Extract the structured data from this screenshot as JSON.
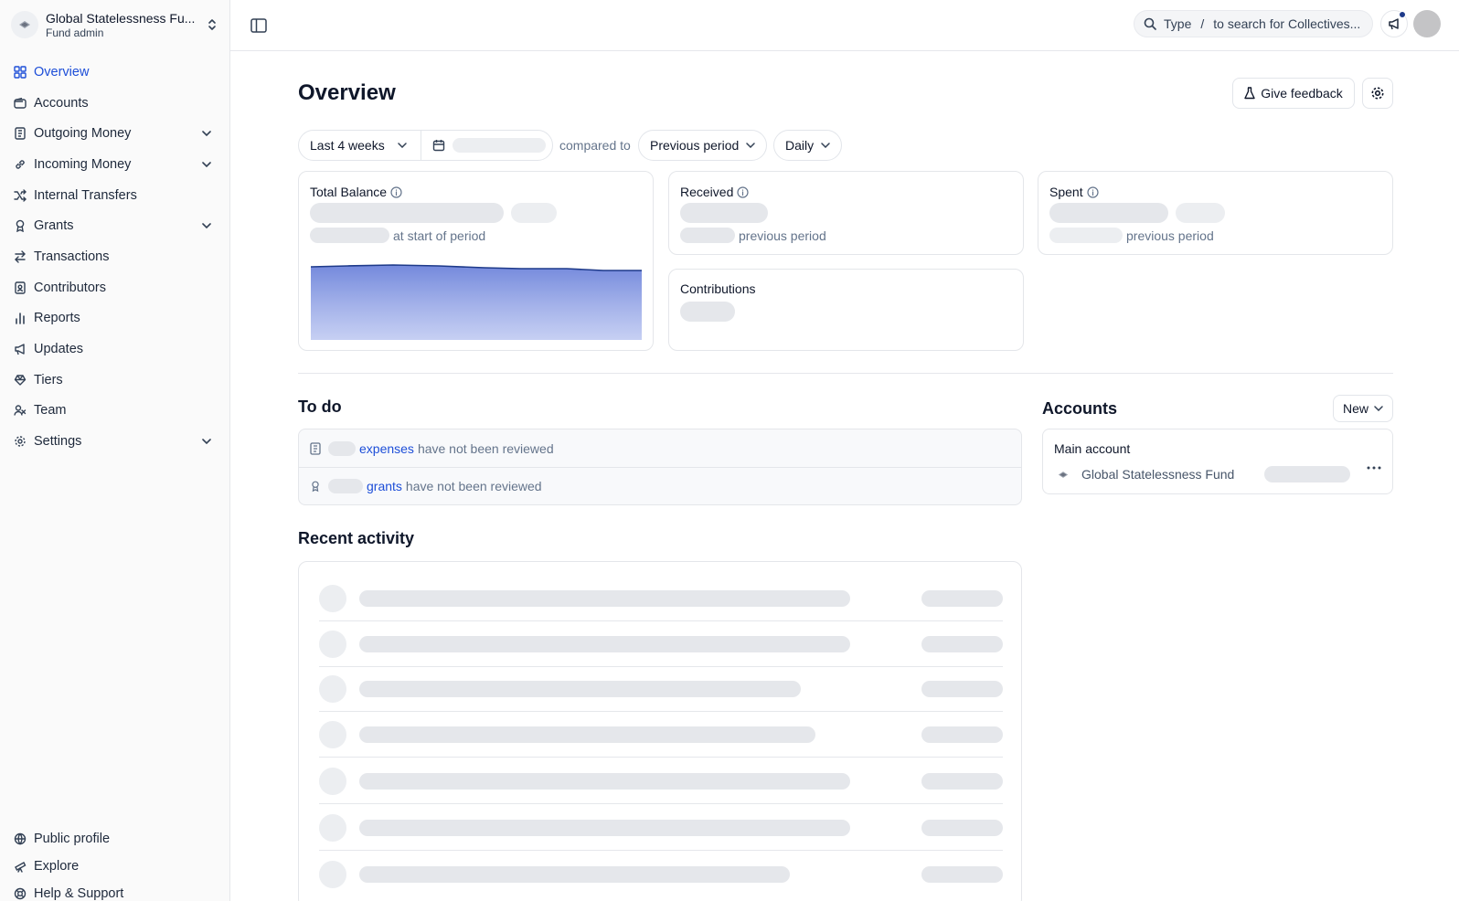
{
  "org": {
    "name": "Global Statelessness Fu...",
    "role": "Fund admin"
  },
  "nav": [
    {
      "label": "Overview",
      "icon": "grid-icon",
      "active": true
    },
    {
      "label": "Accounts",
      "icon": "wallet-icon"
    },
    {
      "label": "Outgoing Money",
      "icon": "receipt-icon",
      "expandable": true
    },
    {
      "label": "Incoming Money",
      "icon": "link-icon",
      "expandable": true
    },
    {
      "label": "Internal Transfers",
      "icon": "shuffle-icon"
    },
    {
      "label": "Grants",
      "icon": "award-icon",
      "expandable": true
    },
    {
      "label": "Transactions",
      "icon": "arrows-icon"
    },
    {
      "label": "Contributors",
      "icon": "contacts-icon"
    },
    {
      "label": "Reports",
      "icon": "bar-chart-icon"
    },
    {
      "label": "Updates",
      "icon": "megaphone-icon"
    },
    {
      "label": "Tiers",
      "icon": "tag-icon"
    },
    {
      "label": "Team",
      "icon": "users-icon"
    },
    {
      "label": "Settings",
      "icon": "gear-icon",
      "expandable": true
    }
  ],
  "nav_bottom": [
    {
      "label": "Public profile",
      "icon": "globe-icon"
    },
    {
      "label": "Explore",
      "icon": "telescope-icon"
    },
    {
      "label": "Help & Support",
      "icon": "lifebuoy-icon"
    }
  ],
  "search": {
    "type": "Type",
    "slash": "/",
    "hint": "to search for Collectives..."
  },
  "page": {
    "title": "Overview",
    "feedback_label": "Give feedback"
  },
  "filters": {
    "period": "Last 4 weeks",
    "compared_to": "compared to",
    "comparison": "Previous period",
    "interval": "Daily"
  },
  "cards": {
    "total_balance": {
      "title": "Total Balance",
      "sub": "at start of period"
    },
    "received": {
      "title": "Received",
      "sub": "previous period"
    },
    "spent": {
      "title": "Spent",
      "sub": "previous period"
    },
    "contributions": {
      "title": "Contributions"
    }
  },
  "balance_chart": {
    "type": "area",
    "color": "#3b5bdb"
  },
  "todo": {
    "title": "To do",
    "items": [
      {
        "link": "expenses",
        "text": "have not been reviewed",
        "icon": "receipt-icon"
      },
      {
        "link": "grants",
        "text": "have not been reviewed",
        "icon": "award-icon"
      }
    ]
  },
  "accounts": {
    "title": "Accounts",
    "new_label": "New",
    "main_title": "Main account",
    "main_name": "Global Statelessness Fund"
  },
  "activity": {
    "title": "Recent activity",
    "rows": 7
  },
  "colors": {
    "accent": "#1d4ed8",
    "skeleton": "#e5e7eb"
  }
}
